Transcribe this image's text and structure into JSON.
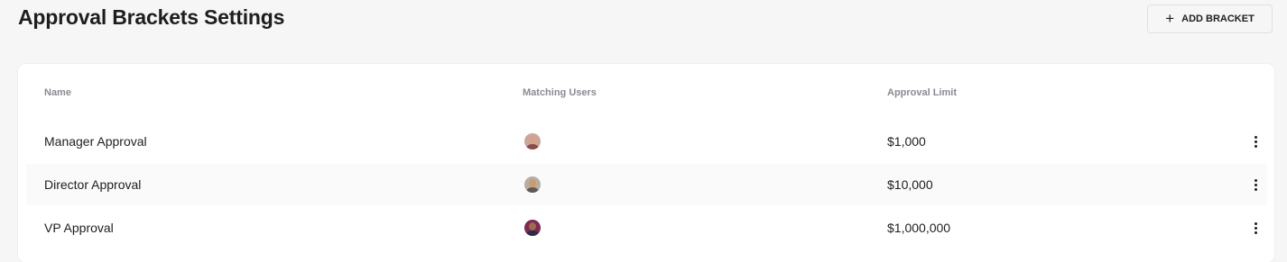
{
  "header": {
    "title": "Approval Brackets Settings",
    "add_button_label": "ADD BRACKET"
  },
  "table": {
    "columns": [
      "Name",
      "Matching Users",
      "Approval Limit"
    ],
    "rows": [
      {
        "name": "Manager Approval",
        "limit": "$1,000",
        "avatar": {
          "bg": "#c9a79c",
          "skin": "#d9a184",
          "shirt": "#8a4b4b"
        }
      },
      {
        "name": "Director Approval",
        "limit": "$10,000",
        "avatar": {
          "bg": "#b8ada0",
          "skin": "#c89b72",
          "shirt": "#5e5a55"
        }
      },
      {
        "name": "VP Approval",
        "limit": "$1,000,000",
        "avatar": {
          "bg": "#7b2a52",
          "skin": "#a26a4d",
          "shirt": "#2d2a4a"
        }
      }
    ]
  }
}
